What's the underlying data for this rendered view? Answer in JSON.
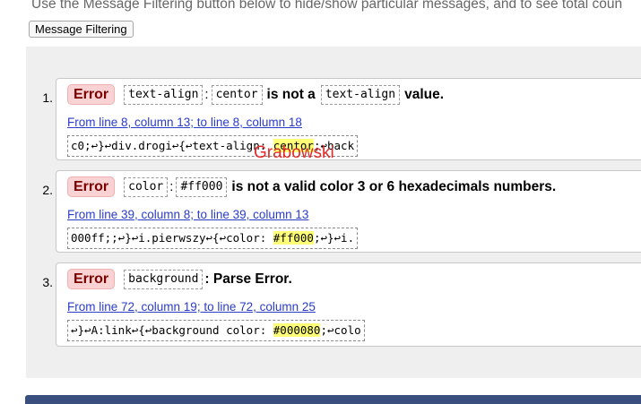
{
  "intro_text": "Use the Message Filtering button below to hide/show particular messages, and to see total coun",
  "filter_button_label": "Message Filtering",
  "errors": [
    {
      "number": "1.",
      "badge": "Error",
      "property": "text-align",
      "value": "centor",
      "message": "is not a",
      "suffix_code": "text-align",
      "suffix_text": "value.",
      "location": "From line 8, column 13; to line 8, column 18",
      "snippet_pre": "c0;↩}↩div.drogi↩{↩text-align: ",
      "snippet_hl": "centor",
      "snippet_post": ";↩back"
    },
    {
      "number": "2.",
      "badge": "Error",
      "property": "color",
      "value": "#ff000",
      "message": "is not a valid color 3 or 6 hexadecimals numbers.",
      "location": "From line 39, column 8; to line 39, column 13",
      "snippet_pre": "000ff;;↩}↩i.pierwszy↩{↩color: ",
      "snippet_hl": "#ff000",
      "snippet_post": ";↩}↩i."
    },
    {
      "number": "3.",
      "badge": "Error",
      "property": "background",
      "message": ": Parse Error.",
      "location": "From line 72, column 19; to line 72, column 25",
      "snippet_pre": "↩}↩A:link↩{↩background color: ",
      "snippet_hl": "#000080",
      "snippet_post": ";↩colo"
    }
  ],
  "watermark": "Grabowski",
  "colors": {
    "badge_bg": "#f9d3d3",
    "link": "#2a3cc8",
    "highlight": "#ffff77",
    "watermark": "#e12a2a"
  }
}
